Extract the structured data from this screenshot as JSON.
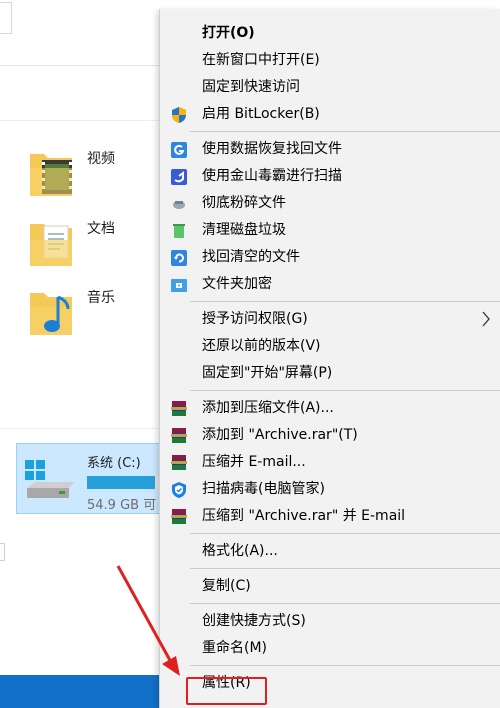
{
  "explorer": {
    "folders": [
      {
        "label": "视频",
        "icon": "video-folder-icon"
      },
      {
        "label": "文档",
        "icon": "document-folder-icon"
      },
      {
        "label": "音乐",
        "icon": "music-folder-icon"
      }
    ],
    "drive": {
      "label": "系统 (C:)",
      "free_text": "54.9 GB 可",
      "used_fraction": 0.85,
      "bar_color": "#26a0da"
    }
  },
  "taskbar": {
    "color": "#1170c9"
  },
  "context_menu": {
    "groups": [
      [
        {
          "label": "打开(O)",
          "bold": true,
          "icon": ""
        },
        {
          "label": "在新窗口中打开(E)",
          "icon": ""
        },
        {
          "label": "固定到快速访问",
          "icon": ""
        },
        {
          "label": "启用 BitLocker(B)",
          "icon": "shield-icon"
        }
      ],
      [
        {
          "label": "使用数据恢复找回文件",
          "icon": "data-recovery-icon"
        },
        {
          "label": "使用金山毒霸进行扫描",
          "icon": "antivirus-scan-icon"
        },
        {
          "label": "彻底粉碎文件",
          "icon": "shredder-icon"
        },
        {
          "label": "清理磁盘垃圾",
          "icon": "trash-clean-icon"
        },
        {
          "label": "找回清空的文件",
          "icon": "restore-icon"
        },
        {
          "label": "文件夹加密",
          "icon": "folder-encrypt-icon"
        }
      ],
      [
        {
          "label": "授予访问权限(G)",
          "icon": "",
          "submenu": true
        },
        {
          "label": "还原以前的版本(V)",
          "icon": ""
        },
        {
          "label": "固定到\"开始\"屏幕(P)",
          "icon": ""
        }
      ],
      [
        {
          "label": "添加到压缩文件(A)...",
          "icon": "winrar-icon"
        },
        {
          "label": "添加到 \"Archive.rar\"(T)",
          "icon": "winrar-icon"
        },
        {
          "label": "压缩并 E-mail...",
          "icon": "winrar-icon"
        },
        {
          "label": "扫描病毒(电脑管家)",
          "icon": "pc-manager-shield-icon"
        },
        {
          "label": "压缩到 \"Archive.rar\" 并 E-mail",
          "icon": "winrar-icon"
        }
      ],
      [
        {
          "label": "格式化(A)...",
          "icon": ""
        }
      ],
      [
        {
          "label": "复制(C)",
          "icon": ""
        }
      ],
      [
        {
          "label": "创建快捷方式(S)",
          "icon": ""
        },
        {
          "label": "重命名(M)",
          "icon": ""
        }
      ],
      [
        {
          "label": "属性(R)",
          "icon": "",
          "highlighted": true
        }
      ]
    ]
  },
  "colors": {
    "menu_bg": "#f2f2f2",
    "highlight": "#e02020",
    "selection_bg": "#cce8ff"
  }
}
